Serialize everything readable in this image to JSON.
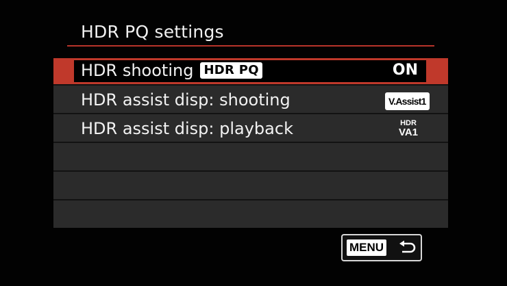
{
  "screen": {
    "title": "HDR PQ settings"
  },
  "menu": {
    "items": [
      {
        "label": "HDR shooting",
        "badge": "HDR PQ",
        "value": "ON"
      },
      {
        "label": "HDR assist disp: shooting",
        "value_icon": "V.Assist1"
      },
      {
        "label": "HDR assist disp: playback",
        "value_icon_line1": "HDR",
        "value_icon_line2": "VA1"
      }
    ]
  },
  "footer": {
    "menu_label": "MENU",
    "return_icon": "return-arrow-icon"
  },
  "colors": {
    "accent": "#c0392b",
    "panel": "#2b2b2b",
    "background": "#020202"
  }
}
